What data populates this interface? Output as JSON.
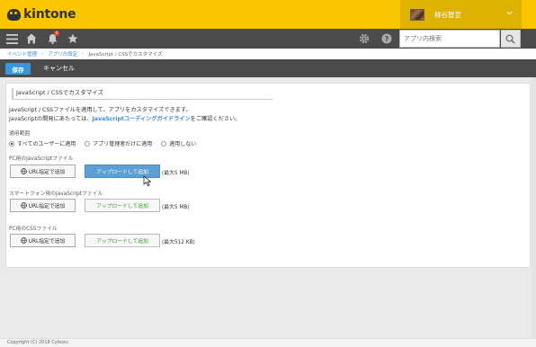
{
  "app": {
    "logo_text": "kintone"
  },
  "user": {
    "name": "柳谷智宣"
  },
  "search": {
    "placeholder": "アプリ内検索"
  },
  "nav": {
    "notification_count": "4"
  },
  "breadcrumb": [
    {
      "label": "イベント管理"
    },
    {
      "label": "アプリの設定"
    },
    {
      "label": "JavaScript / CSSでカスタマイズ"
    }
  ],
  "actions": {
    "save_label": "保存",
    "cancel_label": "キャンセル"
  },
  "section": {
    "title": "JavaScript / CSSでカスタマイズ",
    "desc_line1": "JavaScript / CSSファイルを適用して、アプリをカスタマイズできます。",
    "desc_line2_prefix": "JavaScriptの開発にあたっては、",
    "desc_line2_link": "JavaScriptコーディングガイドライン",
    "desc_line2_suffix": "をご確認ください。",
    "scope_label": "適用範囲",
    "scope_options": [
      {
        "label": "すべてのユーザーに適用",
        "checked": true
      },
      {
        "label": "アプリ管理者だけに適用",
        "checked": false
      },
      {
        "label": "適用しない",
        "checked": false
      }
    ],
    "groups": [
      {
        "label": "PC用のJavaScriptファイル",
        "url_button": "URL指定で追加",
        "upload_button": "アップロードして追加",
        "max_size": "(最大5 MB)"
      },
      {
        "label": "スマートフォン用のJavaScriptファイル",
        "url_button": "URL指定で追加",
        "upload_button": "アップロードして追加",
        "max_size": "(最大5 MB)"
      },
      {
        "label": "PC用のCSSファイル",
        "url_button": "URL指定で追加",
        "upload_button": "アップロードして追加",
        "max_size": "(最大512 KB)"
      }
    ]
  },
  "footer": {
    "copyright": "Copyright (C) 2018 Cybozu"
  }
}
